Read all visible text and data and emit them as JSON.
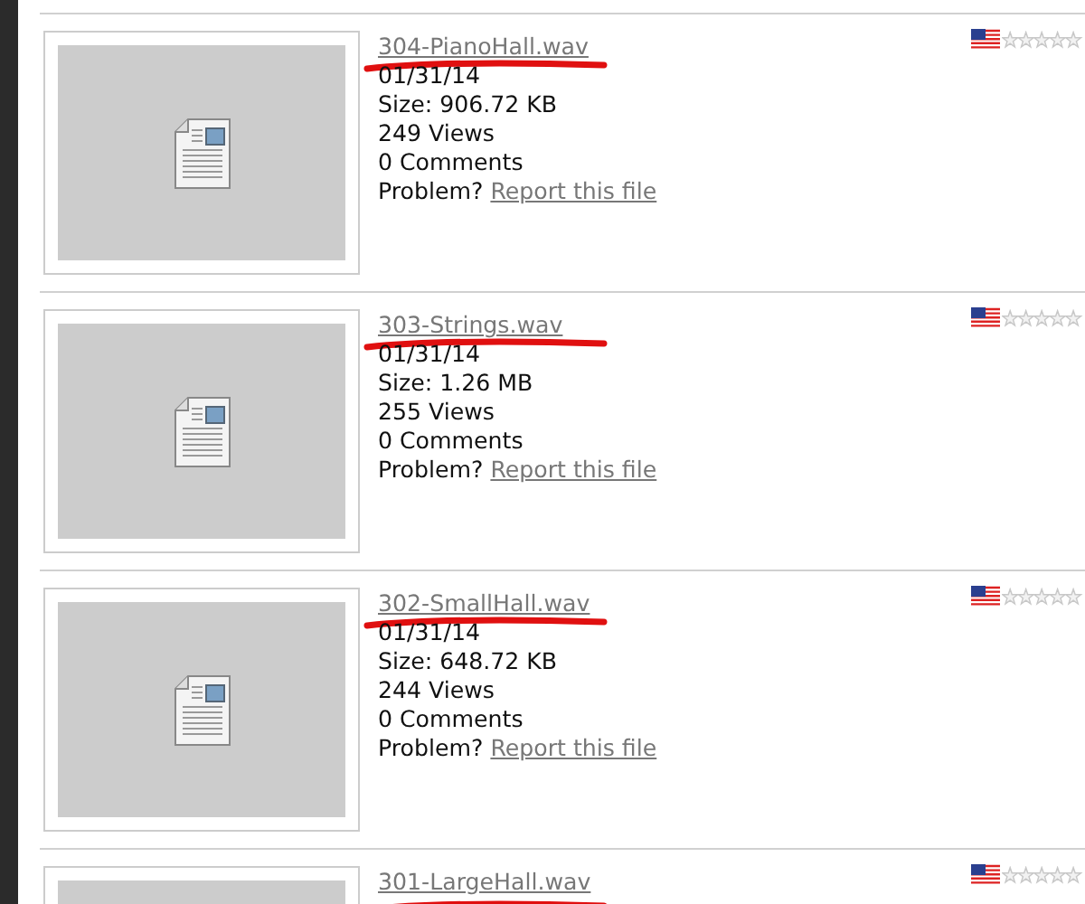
{
  "files": [
    {
      "title": "304-PianoHall.wav",
      "date": "01/31/14",
      "size": "Size: 906.72 KB",
      "views": "249 Views",
      "comments": "0 Comments",
      "problem": "Problem?",
      "report": "Report this file",
      "stars": 0
    },
    {
      "title": "303-Strings.wav",
      "date": "01/31/14",
      "size": "Size: 1.26 MB",
      "views": "255 Views",
      "comments": "0 Comments",
      "problem": "Problem?",
      "report": "Report this file",
      "stars": 0
    },
    {
      "title": "302-SmallHall.wav",
      "date": "01/31/14",
      "size": "Size: 648.72 KB",
      "views": "244 Views",
      "comments": "0 Comments",
      "problem": "Problem?",
      "report": "Report this file",
      "stars": 0
    },
    {
      "title": "301-LargeHall.wav",
      "stars": 0
    }
  ]
}
